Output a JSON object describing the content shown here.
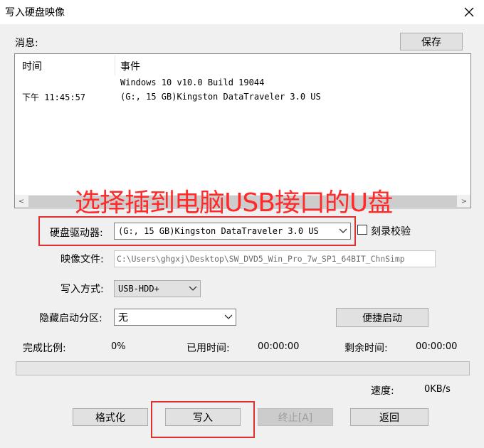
{
  "window": {
    "title": "写入硬盘映像",
    "close_symbol": "✕"
  },
  "messages": {
    "label": "消息:",
    "save_label": "保存",
    "columns": {
      "time": "时间",
      "event": "事件"
    },
    "rows": [
      {
        "time": "",
        "event": "Windows 10 v10.0 Build 19044"
      },
      {
        "time": "下午 11:45:57",
        "event": "(G:, 15 GB)Kingston DataTraveler 3.0 US"
      }
    ],
    "scroll_left": "<",
    "scroll_right": ">"
  },
  "annotation": {
    "text": "选择插到电脑USB接口的U盘",
    "color": "#ff2a2a"
  },
  "drive": {
    "label": "硬盘驱动器:",
    "value": "(G:, 15 GB)Kingston DataTraveler 3.0 US",
    "verify_label": "刻录校验",
    "verify_checked": false
  },
  "image_file": {
    "label": "映像文件:",
    "value": "C:\\Users\\ghgxj\\Desktop\\SW_DVD5_Win_Pro_7w_SP1_64BIT_ChnSimp"
  },
  "write_method": {
    "label": "写入方式:",
    "value": "USB-HDD+"
  },
  "hidden_partition": {
    "label": "隐藏启动分区:",
    "value": "无"
  },
  "quick_boot_label": "便捷启动",
  "status": {
    "completion_label": "完成比例:",
    "completion_value": "0%",
    "elapsed_label": "已用时间:",
    "elapsed_value": "00:00:00",
    "remaining_label": "剩余时间:",
    "remaining_value": "00:00:00",
    "speed_label": "速度:",
    "speed_value": "0KB/s",
    "progress": 0
  },
  "buttons": {
    "format": "格式化",
    "write": "写入",
    "stop": "终止[A]",
    "back": "返回"
  },
  "colors": {
    "highlight": "#e03030",
    "window_bg": "#f0f0f0"
  }
}
